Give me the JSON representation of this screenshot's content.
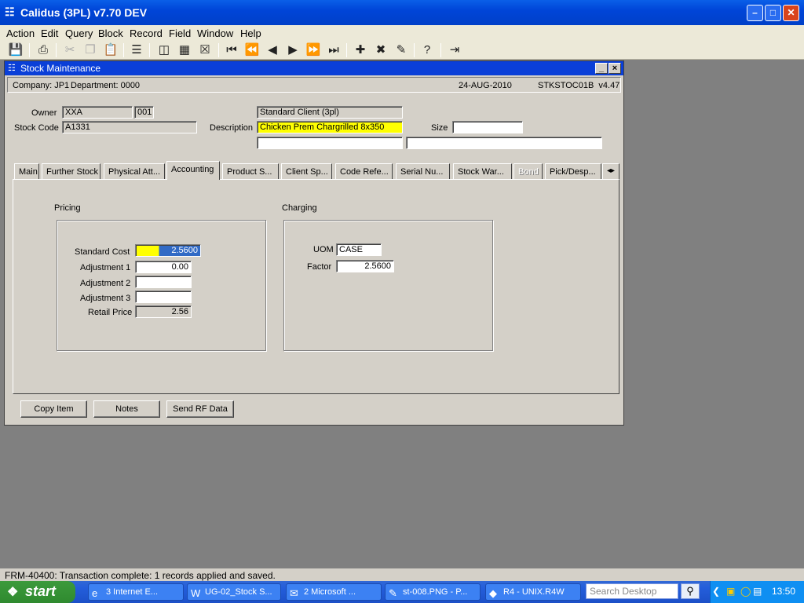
{
  "app": {
    "title": "Calidus (3PL) v7.70 DEV"
  },
  "menu": [
    "Action",
    "Edit",
    "Query",
    "Block",
    "Record",
    "Field",
    "Window",
    "Help"
  ],
  "form": {
    "title": "Stock Maintenance",
    "info": {
      "company": "Company: JP1",
      "department": "Department: 0000",
      "date": "24-AUG-2010",
      "form_id": "STKSTOC01B  v4.47"
    },
    "owner_label": "Owner",
    "owner_code": "XXA",
    "owner_sub": "001",
    "owner_name": "Standard Client (3pl)",
    "stock_code_label": "Stock Code",
    "stock_code": "A1331",
    "description_label": "Description",
    "description": "Chicken Prem Chargrilled 8x350",
    "size_label": "Size",
    "size": "",
    "tabs": [
      "Main",
      "Further Stock",
      "Physical Att...",
      "Accounting",
      "Product S...",
      "Client Sp...",
      "Code Refe...",
      "Serial Nu...",
      "Stock War...",
      "Bond",
      "Pick/Desp..."
    ],
    "active_tab": "Accounting",
    "pricing": {
      "title": "Pricing",
      "standard_cost_label": "Standard Cost",
      "standard_cost": "2.5600",
      "adj1_label": "Adjustment 1",
      "adj1": "0.00",
      "adj2_label": "Adjustment 2",
      "adj2": "",
      "adj3_label": "Adjustment 3",
      "adj3": "",
      "retail_label": "Retail Price",
      "retail": "2.56"
    },
    "charging": {
      "title": "Charging",
      "uom_label": "UOM",
      "uom": "CASE",
      "factor_label": "Factor",
      "factor": "2.5600"
    },
    "buttons": {
      "copy": "Copy Item",
      "notes": "Notes",
      "send_rf": "Send RF Data"
    }
  },
  "status": "FRM-40400: Transaction complete: 1 records applied and saved.",
  "taskbar": {
    "start": "start",
    "tasks": [
      "3 Internet E...",
      "UG-02_Stock S...",
      "2 Microsoft ...",
      "st-008.PNG - P...",
      "R4 - UNIX.R4W"
    ],
    "search_placeholder": "Search Desktop",
    "clock": "13:50"
  }
}
